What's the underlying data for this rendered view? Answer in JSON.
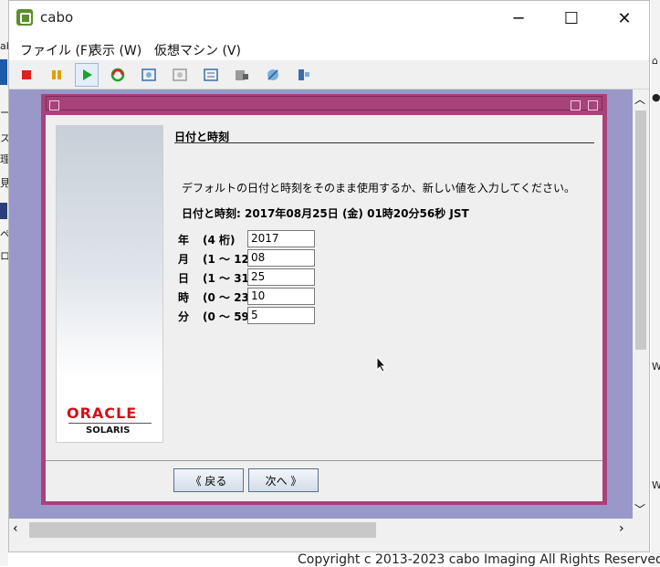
{
  "window": {
    "title": "cabo",
    "controls": {
      "minimize": "─",
      "maximize": "☐",
      "close": "✕"
    }
  },
  "menu": [
    "ファイル (F)",
    "表示 (W)",
    "仮想マシン (V)"
  ],
  "toolbar_icons": [
    "stop-icon",
    "pause-icon",
    "play-icon",
    "reset-icon",
    "snapshot-icon",
    "revert-icon",
    "snapshot-manager-icon",
    "settings-icon",
    "connect-icon",
    "tools-icon"
  ],
  "dialog": {
    "section_title": "日付と時刻",
    "instruction": "デフォルトの日付と時刻をそのまま使用するか、新しい値を入力してください。",
    "current_datetime": "日付と時刻: 2017年08月25日 (金) 01時20分56秒 JST",
    "fields": [
      {
        "label": "年",
        "range": "(4 桁)",
        "value": "2017"
      },
      {
        "label": "月",
        "range": "(1 ～ 12)",
        "value": "08"
      },
      {
        "label": "日",
        "range": "(1 ～ 31)",
        "value": "25"
      },
      {
        "label": "時",
        "range": "(0 ～ 23)",
        "value": "10"
      },
      {
        "label": "分",
        "range": "(0 ～ 59)",
        "value": "5"
      }
    ],
    "back_button": "《 戻る",
    "next_button": "次へ 》",
    "logo": {
      "brand": "ORACLE",
      "product": "SOLARIS"
    }
  },
  "colors": {
    "console_bg": "#9a98c8",
    "dialog_frame": "#a8427a",
    "oracle_red": "#d3101b"
  },
  "copyright": "Copyright c 2013-2023 cabo Imaging All Rights Reserved."
}
